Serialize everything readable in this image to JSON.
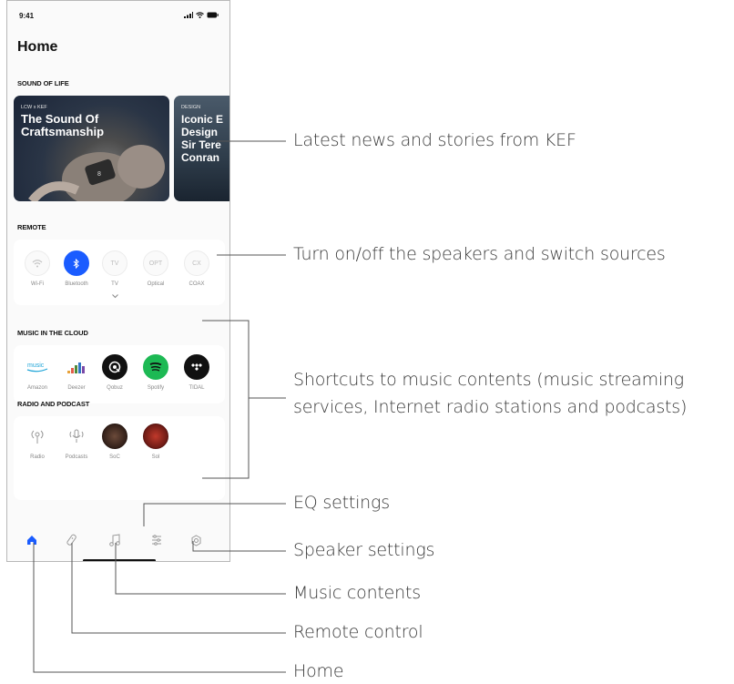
{
  "status_bar": {
    "time": "9:41"
  },
  "page": {
    "title": "Home"
  },
  "sound_of_life": {
    "label": "SOUND OF LIFE",
    "cards": [
      {
        "kicker": "LCW x KEF",
        "title": "The Sound Of\nCraftsmanship"
      },
      {
        "kicker": "DESIGN",
        "title": "Iconic E\nDesign\nSir Tere\nConran"
      }
    ]
  },
  "remote": {
    "label": "REMOTE",
    "sources": [
      {
        "icon": "wifi-icon",
        "label": "Wi-Fi",
        "active": false
      },
      {
        "icon": "bluetooth-icon",
        "label": "Bluetooth",
        "active": true
      },
      {
        "icon": "tv-icon",
        "text": "TV",
        "label": "TV",
        "active": false
      },
      {
        "icon": "optical-icon",
        "text": "OPT",
        "label": "Optical",
        "active": false
      },
      {
        "icon": "coax-icon",
        "text": "CX",
        "label": "COAX",
        "active": false
      }
    ]
  },
  "music_cloud": {
    "label": "MUSIC IN THE CLOUD",
    "services": [
      {
        "icon": "amazon-music-icon",
        "label": "Amazon"
      },
      {
        "icon": "deezer-icon",
        "label": "Deezer"
      },
      {
        "icon": "qobuz-icon",
        "label": "Qobuz"
      },
      {
        "icon": "spotify-icon",
        "label": "Spotify"
      },
      {
        "icon": "tidal-icon",
        "label": "TIDAL"
      }
    ]
  },
  "radio_podcast": {
    "label": "RADIO AND PODCAST",
    "items": [
      {
        "icon": "radio-icon",
        "label": "Radio"
      },
      {
        "icon": "podcast-icon",
        "label": "Podcasts"
      },
      {
        "icon": "soc-cover-icon",
        "label": "SoC"
      },
      {
        "icon": "sol-cover-icon",
        "label": "Sol"
      }
    ]
  },
  "nav": [
    {
      "icon": "home-icon",
      "active": true
    },
    {
      "icon": "remote-control-icon",
      "active": false
    },
    {
      "icon": "music-note-icon",
      "active": false
    },
    {
      "icon": "eq-sliders-icon",
      "active": false
    },
    {
      "icon": "settings-icon",
      "active": false
    }
  ],
  "callouts": {
    "news": "Latest news and stories from KEF",
    "remote": "Turn on/off the speakers and switch sources",
    "shortcuts_line1": "Shortcuts to music contents (music streaming",
    "shortcuts_line2": "services, Internet radio stations and podcasts)",
    "eq": "EQ settings",
    "speaker_settings": "Speaker settings",
    "music_contents": "Music contents",
    "remote_control": "Remote control",
    "home": "Home"
  },
  "colors": {
    "accent": "#1a5cff",
    "spotify": "#1db954",
    "amazon": "#25a7d8",
    "callout_text": "#3a3a3a"
  }
}
